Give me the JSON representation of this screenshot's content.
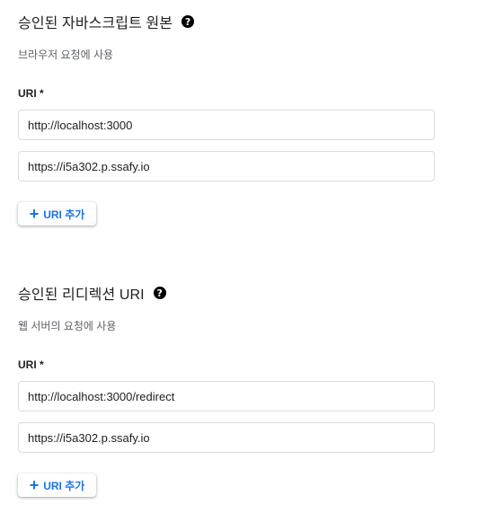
{
  "sections": [
    {
      "title": "승인된 자바스크립트 원본",
      "help_icon": "help-icon",
      "subtitle": "브라우저 요청에 사용",
      "field_label": "URI *",
      "uris": [
        "http://localhost:3000",
        "https://i5a302.p.ssafy.io"
      ],
      "add_button": {
        "icon": "plus-icon",
        "label": "URI 추가"
      }
    },
    {
      "title": "승인된 리디렉션 URI",
      "help_icon": "help-icon",
      "subtitle": "웹 서버의 요청에 사용",
      "field_label": "URI *",
      "uris": [
        "http://localhost:3000/redirect",
        "https://i5a302.p.ssafy.io"
      ],
      "add_button": {
        "icon": "plus-icon",
        "label": "URI 추가"
      }
    }
  ],
  "colors": {
    "accent": "#1a73e8",
    "text": "#202124",
    "secondary_text": "#5f6368",
    "border": "#dadce0"
  }
}
